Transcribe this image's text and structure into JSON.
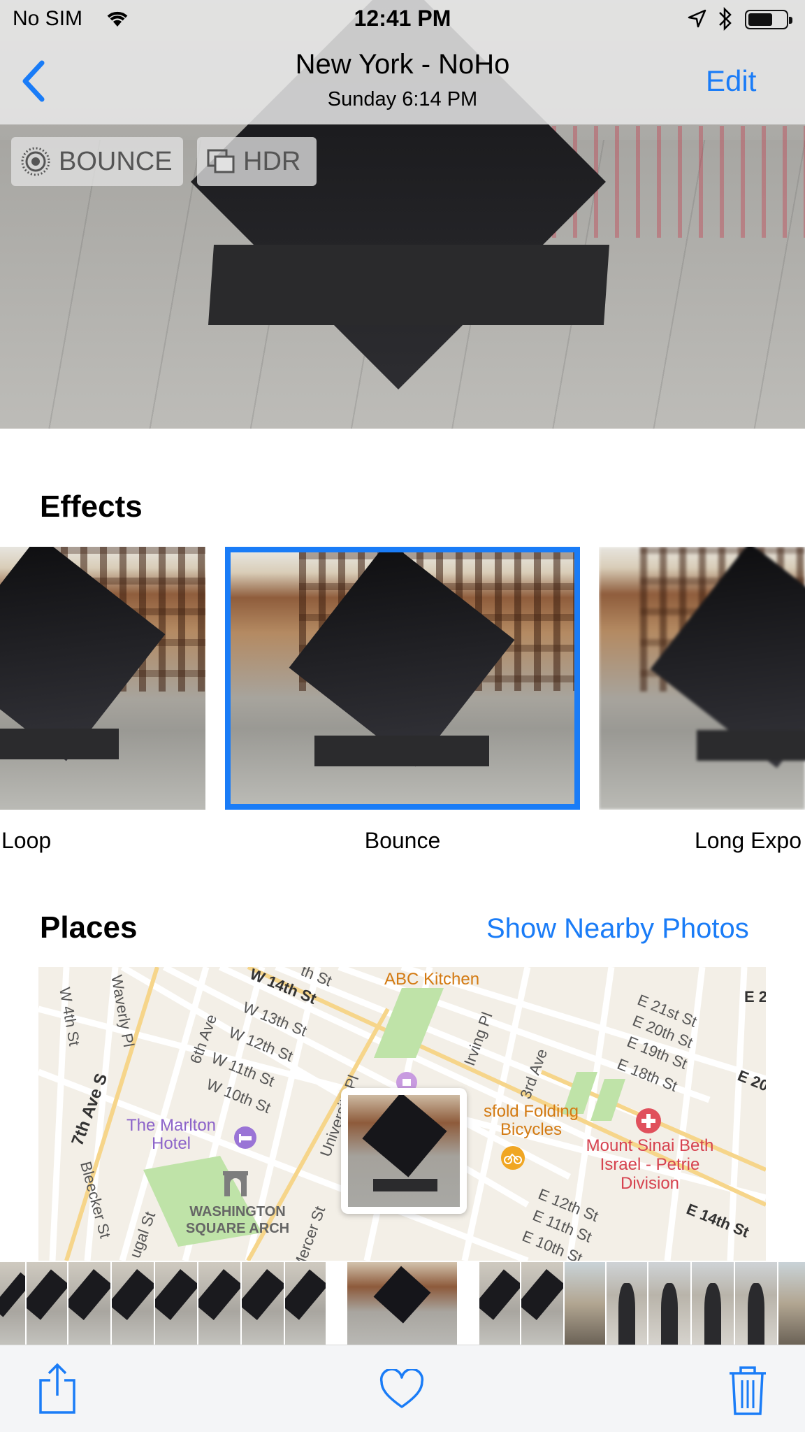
{
  "status_bar": {
    "carrier": "No SIM",
    "time": "12:41 PM",
    "icons": [
      "wifi-icon",
      "location-arrow-icon",
      "bluetooth-icon",
      "battery-icon"
    ]
  },
  "nav": {
    "back_icon": "chevron-left-icon",
    "title": "New York - NoHo",
    "subtitle": "Sunday  6:14 PM",
    "edit_label": "Edit"
  },
  "badges": [
    {
      "icon": "live-photo-icon",
      "label": "BOUNCE"
    },
    {
      "icon": "hdr-icon",
      "label": "HDR"
    }
  ],
  "effects": {
    "title": "Effects",
    "items": [
      {
        "label": "Loop",
        "selected": false
      },
      {
        "label": "Bounce",
        "selected": true
      },
      {
        "label": "Long Expo",
        "selected": false
      }
    ]
  },
  "places": {
    "title": "Places",
    "link": "Show Nearby Photos",
    "map": {
      "streets": [
        "W 14th St",
        "W 13th St",
        "W 12th St",
        "W 11th St",
        "W 10th St",
        "W 4th St",
        "Waverly Pl",
        "7th Ave S",
        "6th Ave",
        "Bleecker St",
        "ugal St",
        "Mercer St",
        "University Pl",
        "Irving Pl",
        "3rd Ave",
        "E 21st St",
        "E 20th St",
        "E 19th St",
        "E 18th St",
        "E 12th St",
        "E 11th St",
        "E 10th St",
        "E 14th St",
        "E 2",
        "E 20",
        "th St"
      ],
      "pois": [
        {
          "name": "ABC Kitchen",
          "icon": "restaurant-icon"
        },
        {
          "name": "The Marlton Hotel",
          "icon": "hotel-icon"
        },
        {
          "name": "WASHINGTON SQUARE ARCH",
          "icon": "landmark-icon"
        },
        {
          "name": "Mount Sinai Beth Israel - Petrie Division",
          "icon": "hospital-icon"
        },
        {
          "name": "sfold Folding Bicycles",
          "icon": "bicycle-icon"
        }
      ]
    }
  },
  "filmstrip": {
    "frame_count": 20,
    "selected_index": 8
  },
  "toolbar": {
    "icons": [
      "share-icon",
      "heart-icon",
      "trash-icon"
    ]
  },
  "colors": {
    "accent": "#1a7cf7",
    "toolbar_bg": "#f4f5f7",
    "map_bg": "#f3efe7"
  }
}
